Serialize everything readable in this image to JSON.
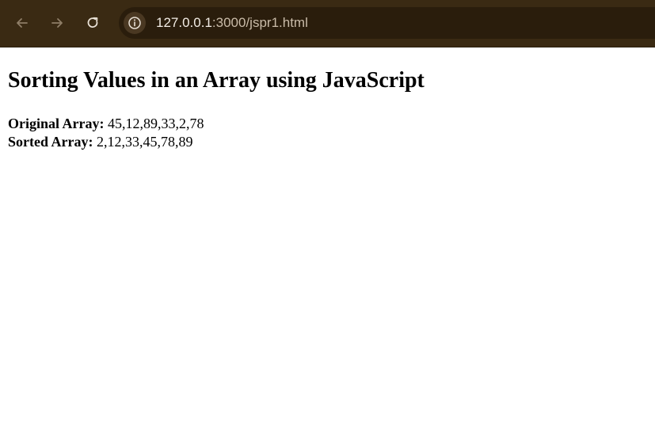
{
  "browser": {
    "url_host": "127.0.0.1",
    "url_path": ":3000/jspr1.html",
    "icons": {
      "back": "arrow-left-icon",
      "forward": "arrow-right-icon",
      "reload": "reload-icon",
      "site_info": "info-icon"
    },
    "colors": {
      "toolbar": "#3a2a13",
      "omnibox": "#2a1d0c",
      "url_text": "#e9e1d6"
    }
  },
  "page": {
    "title": "Sorting Values in an Array using JavaScript",
    "original_label": "Original Array:",
    "original_values": "45,12,89,33,2,78",
    "sorted_label": "Sorted Array:",
    "sorted_values": "2,12,33,45,78,89"
  }
}
